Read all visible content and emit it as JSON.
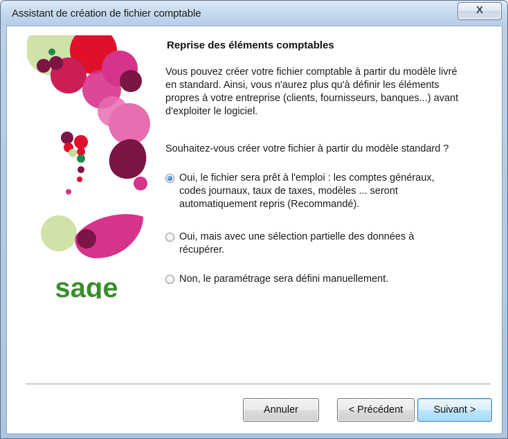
{
  "window": {
    "title": "Assistant de création de fichier comptable",
    "close_label": "X"
  },
  "brand": {
    "logo_text": "sage",
    "logo_color": "#3a8c2c"
  },
  "content": {
    "heading": "Reprise des éléments comptables",
    "paragraph_lines": [
      "Vous pouvez créer votre fichier comptable à partir du modèle livré",
      "en standard. Ainsi, vous n'aurez plus qu'à définir les éléments",
      "propres à votre entreprise (clients, fournisseurs, banques...) avant",
      "d'exploiter le logiciel."
    ],
    "question": "Souhaitez-vous créer votre fichier à partir du modèle standard ?",
    "options": [
      {
        "lines": [
          "Oui, le fichier sera prêt à l'emploi : les comptes généraux,",
          "codes journaux, taux de taxes, modèles ... seront",
          "automatiquement repris (Recommandé)."
        ],
        "checked": true
      },
      {
        "lines": [
          "Oui, mais avec une sélection partielle des données à",
          "récupérer."
        ],
        "checked": false
      },
      {
        "lines": [
          "Non, le paramétrage sera défini manuellement."
        ],
        "checked": false
      }
    ]
  },
  "buttons": {
    "cancel": "Annuler",
    "previous": "< Précédent",
    "next": "Suivant >"
  },
  "colors": {
    "accent_pink": "#d6348b",
    "accent_red": "#e0102a",
    "accent_plum": "#7a1545",
    "accent_green_light": "#c9dd9a",
    "accent_green": "#1f8a4c"
  }
}
